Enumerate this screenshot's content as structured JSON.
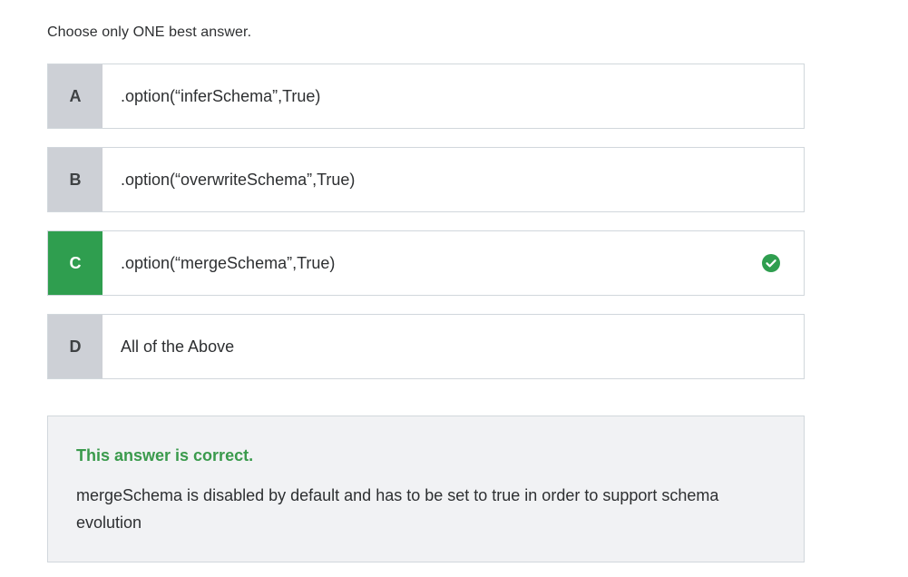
{
  "question": {
    "instruction": "Choose only ONE best answer."
  },
  "options": [
    {
      "letter": "A",
      "text": ".option(“inferSchema”,True)"
    },
    {
      "letter": "B",
      "text": ".option(“overwriteSchema”,True)"
    },
    {
      "letter": "C",
      "text": ".option(“mergeSchema”,True)"
    },
    {
      "letter": "D",
      "text": "All of the Above"
    }
  ],
  "correct_option": "C",
  "icons": {
    "correct": "check-circle-icon"
  },
  "colors": {
    "correct_green": "#2f9e4f",
    "letter_bg": "#cdd0d6",
    "feedback_bg": "#f1f2f4"
  },
  "feedback": {
    "title": "This answer is correct.",
    "body": "mergeSchema is disabled by default and has to be set to true in order to support schema evolution"
  }
}
